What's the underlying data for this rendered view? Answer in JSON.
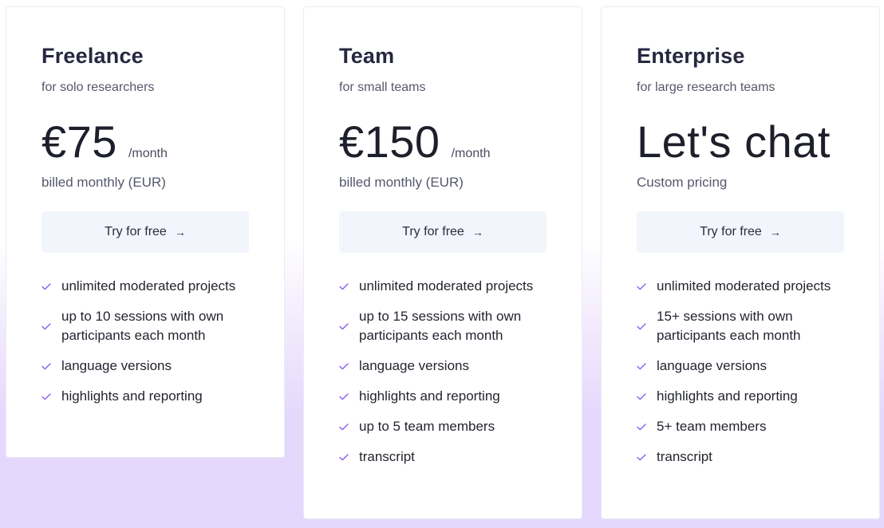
{
  "accent_color": "#8b5cf6",
  "plans": [
    {
      "name": "Freelance",
      "subtitle": "for solo researchers",
      "price": "€75",
      "period": "/month",
      "billing": "billed monthly (EUR)",
      "cta": "Try for free",
      "cta_icon": "arrow-right-icon",
      "features": [
        "unlimited moderated projects",
        "up to 10 sessions with own participants each month",
        "language versions",
        "highlights and reporting"
      ]
    },
    {
      "name": "Team",
      "subtitle": "for small teams",
      "price": "€150",
      "period": "/month",
      "billing": "billed monthly (EUR)",
      "cta": "Try for free",
      "cta_icon": "arrow-right-icon",
      "features": [
        "unlimited moderated projects",
        "up to 15 sessions with own participants each month",
        "language versions",
        "highlights and reporting",
        "up to 5 team members",
        "transcript"
      ]
    },
    {
      "name": "Enterprise",
      "subtitle": "for large research teams",
      "price": "Let's chat",
      "period": "",
      "billing": "Custom pricing",
      "cta": "Try for free",
      "cta_icon": "arrow-right-icon",
      "features": [
        "unlimited moderated projects",
        "15+ sessions with own participants each month",
        "language versions",
        "highlights and reporting",
        "5+ team members",
        "transcript"
      ]
    }
  ]
}
